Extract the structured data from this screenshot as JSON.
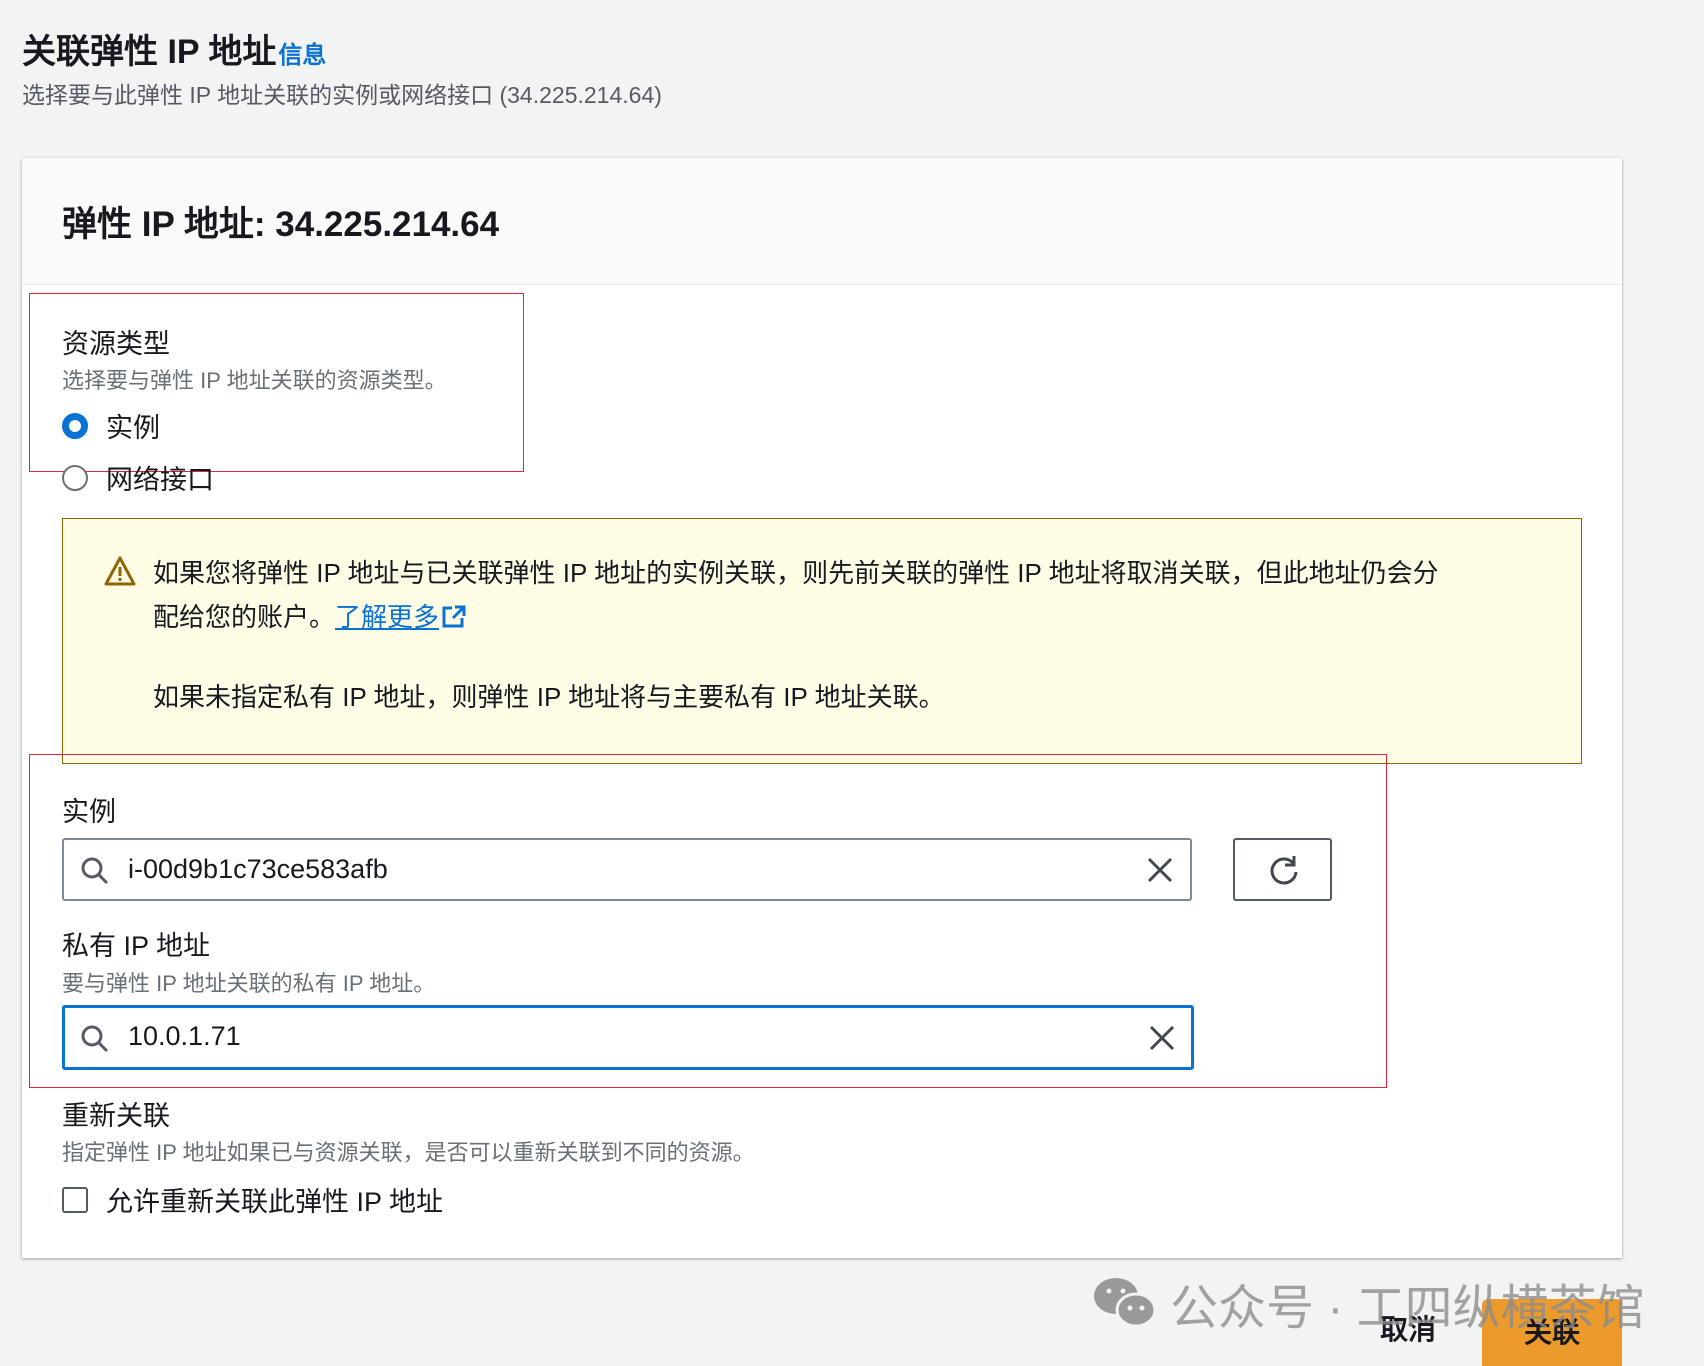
{
  "header": {
    "title": "关联弹性 IP 地址",
    "info_link": "信息",
    "subtitle": "选择要与此弹性 IP 地址关联的实例或网络接口 (34.225.214.64)"
  },
  "card": {
    "title": "弹性 IP 地址: 34.225.214.64"
  },
  "resource_type": {
    "label": "资源类型",
    "description": "选择要与弹性 IP 地址关联的资源类型。",
    "options": [
      {
        "label": "实例",
        "selected": true
      },
      {
        "label": "网络接口",
        "selected": false
      }
    ]
  },
  "warning": {
    "line1": "如果您将弹性 IP 地址与已关联弹性 IP 地址的实例关联，则先前关联的弹性 IP 地址将取消关联，但此地址仍会分",
    "line2": "配给您的账户。",
    "link": "了解更多",
    "line3": "如果未指定私有 IP 地址，则弹性 IP 地址将与主要私有 IP 地址关联。"
  },
  "instance": {
    "label": "实例",
    "value": "i-00d9b1c73ce583afb"
  },
  "private_ip": {
    "label": "私有 IP 地址",
    "description": "要与弹性 IP 地址关联的私有 IP 地址。",
    "value": "10.0.1.71"
  },
  "reassoc": {
    "label": "重新关联",
    "description": "指定弹性 IP 地址如果已与资源关联，是否可以重新关联到不同的资源。",
    "checkbox_label": "允许重新关联此弹性 IP 地址",
    "checked": false
  },
  "footer": {
    "cancel": "取消",
    "submit": "关联"
  },
  "watermark": "公众号 · 工四纵横茶馆",
  "colors": {
    "accent": "#0972d3",
    "primary_button": "#ec9a2c",
    "highlight": "#e0283a"
  }
}
